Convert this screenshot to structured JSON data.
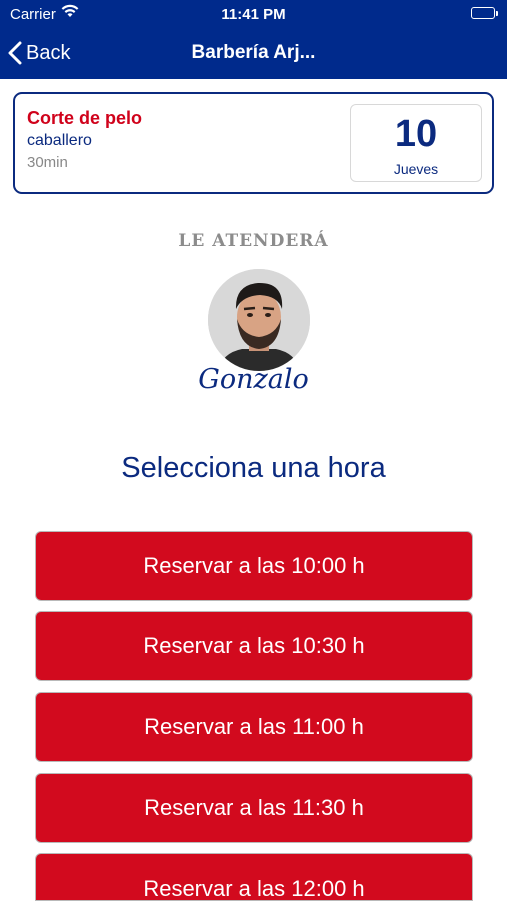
{
  "status_bar": {
    "carrier": "Carrier",
    "time": "11:41 PM"
  },
  "nav": {
    "back_label": "Back",
    "title": "Barbería Arj..."
  },
  "service": {
    "name": "Corte de pelo",
    "subtitle": "caballero",
    "duration": "30min",
    "date_number": "10",
    "date_day": "Jueves"
  },
  "attendant": {
    "label": "LE ATENDERÁ",
    "name": "Gonzalo"
  },
  "booking": {
    "title": "Selecciona una hora",
    "slots": [
      "Reservar a las 10:00 h",
      "Reservar a las 10:30 h",
      "Reservar a las 11:00 h",
      "Reservar a las 11:30 h",
      "Reservar a las 12:00 h"
    ]
  },
  "colors": {
    "header": "#002a8c",
    "brand_blue": "#0b2a7f",
    "accent_red": "#d20a1e"
  }
}
